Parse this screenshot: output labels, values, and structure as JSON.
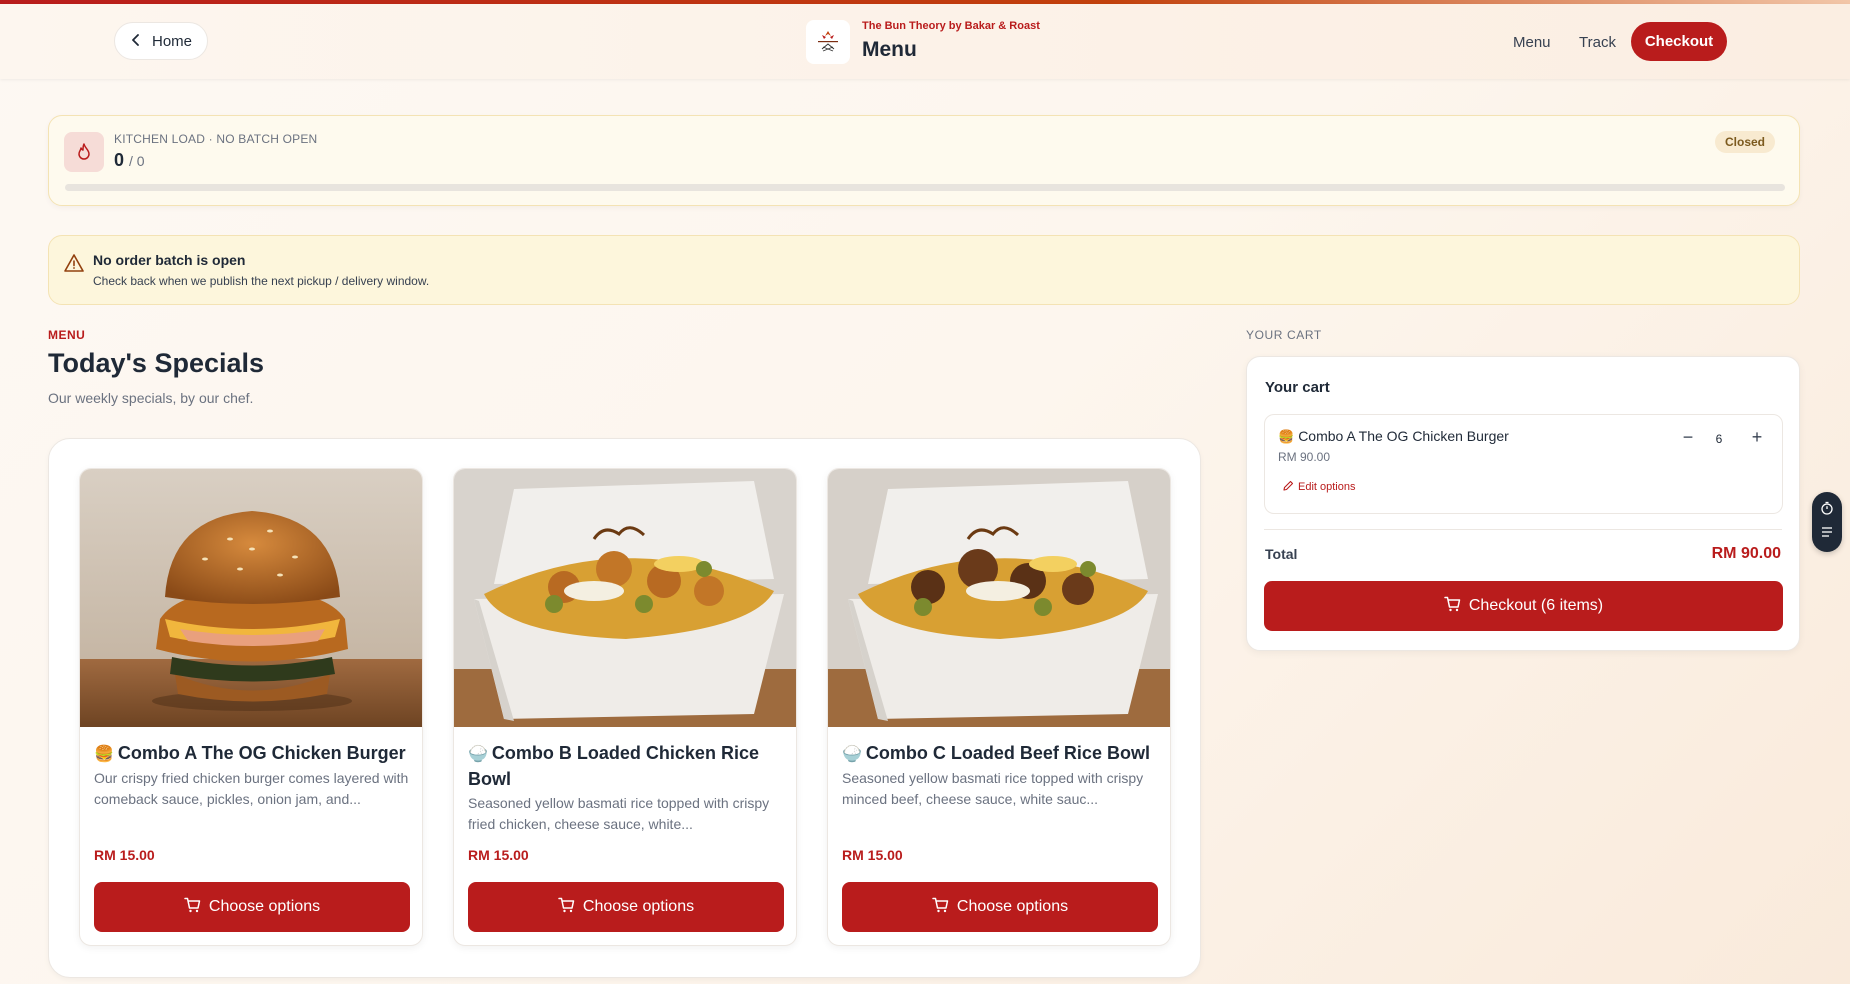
{
  "header": {
    "home_label": "Home",
    "brand_sub": "The Bun Theory by Bakar & Roast",
    "brand_title": "Menu",
    "nav": {
      "menu": "Menu",
      "track": "Track",
      "checkout": "Checkout"
    }
  },
  "kitchen": {
    "label": "KITCHEN LOAD · NO BATCH OPEN",
    "current": "0",
    "capacity": "/ 0",
    "status": "Closed",
    "load_fraction": 0
  },
  "warning": {
    "title": "No order batch is open",
    "text": "Check back when we publish the next pickup / delivery window."
  },
  "menu": {
    "eyebrow": "MENU",
    "title": "Today's Specials",
    "subtitle": "Our weekly specials, by our chef.",
    "items": [
      {
        "emoji": "🍔",
        "name": "Combo A The OG Chicken Burger",
        "description": "Our crispy fried chicken burger comes layered with comeback sauce, pickles, onion jam, and...",
        "price": "RM 15.00",
        "button": "Choose options"
      },
      {
        "emoji": "🍚",
        "name": "Combo B Loaded Chicken Rice Bowl",
        "description": "Seasoned yellow basmati rice topped with crispy fried chicken, cheese sauce, white...",
        "price": "RM 15.00",
        "button": "Choose options"
      },
      {
        "emoji": "🍚",
        "name": "Combo C Loaded Beef Rice Bowl",
        "description": "Seasoned yellow basmati rice topped with crispy minced beef, cheese sauce, white sauc...",
        "price": "RM 15.00",
        "button": "Choose options"
      }
    ]
  },
  "cart": {
    "eyebrow": "YOUR CART",
    "heading": "Your cart",
    "item": {
      "emoji": "🍔",
      "name": "Combo A The OG Chicken Burger",
      "price": "RM 90.00",
      "quantity": "6",
      "minus": "−",
      "plus": "+",
      "edit_label": "Edit options"
    },
    "total_label": "Total",
    "total_value": "RM 90.00",
    "checkout_label": "Checkout (6 items)"
  },
  "icons": {
    "home": "chevron-left-icon",
    "kitchen": "flame-icon",
    "warning": "warning-triangle-icon",
    "cart": "cart-icon",
    "edit": "pencil-icon",
    "timer": "stopwatch-icon",
    "list": "list-icon"
  },
  "colors": {
    "accent": "#b91c1c",
    "warning_bg": "#fdf6dc",
    "badge_bg": "#f8ead0"
  }
}
